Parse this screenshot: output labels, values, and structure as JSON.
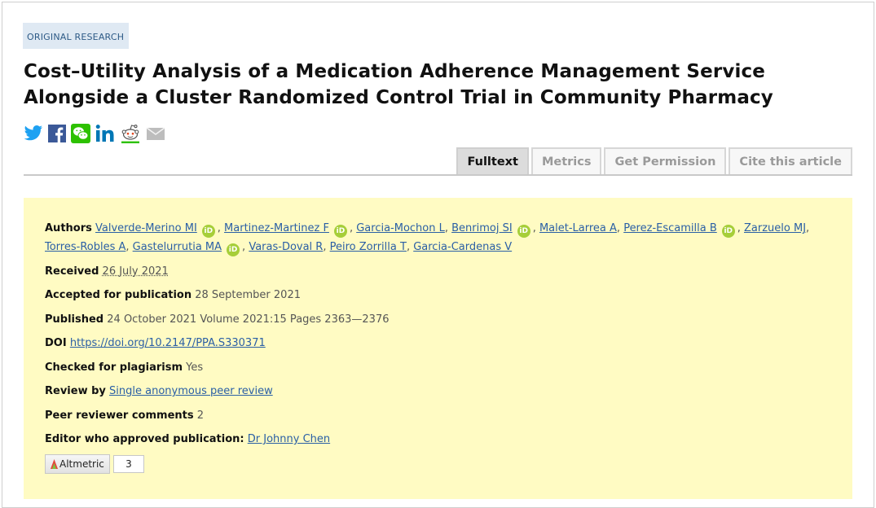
{
  "article": {
    "type_label": "ORIGINAL RESEARCH",
    "title": "Cost–Utility Analysis of a Medication Adherence Management Service Alongside a Cluster Randomized Control Trial in Community Pharmacy"
  },
  "share_icons": [
    "twitter-icon",
    "facebook-icon",
    "wechat-icon",
    "linkedin-icon",
    "reddit-icon",
    "email-icon"
  ],
  "colors": {
    "twitter": "#1da1f2",
    "facebook": "#3b5998",
    "wechat": "#2dc100",
    "linkedin": "#0077b5",
    "orcid": "#a6ce39",
    "meta_bg": "#fffbc3",
    "link": "#2a5fa5"
  },
  "tabs": [
    {
      "label": "Fulltext",
      "active": true
    },
    {
      "label": "Metrics",
      "active": false
    },
    {
      "label": "Get Permission",
      "active": false
    },
    {
      "label": "Cite this article",
      "active": false
    }
  ],
  "meta": {
    "authors_label": "Authors",
    "authors": [
      {
        "name": "Valverde-Merino MI",
        "orcid": true
      },
      {
        "name": "Martinez-Martinez F",
        "orcid": true
      },
      {
        "name": "Garcia-Mochon L",
        "orcid": false
      },
      {
        "name": "Benrimoj SI",
        "orcid": true
      },
      {
        "name": "Malet-Larrea A",
        "orcid": false
      },
      {
        "name": "Perez-Escamilla B",
        "orcid": true
      },
      {
        "name": "Zarzuelo MJ",
        "orcid": false
      },
      {
        "name": "Torres-Robles A",
        "orcid": false
      },
      {
        "name": "Gastelurrutia MA",
        "orcid": true
      },
      {
        "name": "Varas-Doval R",
        "orcid": false
      },
      {
        "name": "Peiro Zorrilla T",
        "orcid": false
      },
      {
        "name": "Garcia-Cardenas V",
        "orcid": false
      }
    ],
    "orcid_label": "iD",
    "received_label": "Received",
    "received": "26 July 2021",
    "accepted_label": "Accepted for publication",
    "accepted": "28 September 2021",
    "published_label": "Published",
    "published": "24 October 2021 Volume 2021:15 Pages 2363—2376",
    "doi_label": "DOI",
    "doi": "https://doi.org/10.2147/PPA.S330371",
    "plagiarism_label": "Checked for plagiarism",
    "plagiarism": "Yes",
    "review_label": "Review by",
    "review": "Single anonymous peer review",
    "comments_label": "Peer reviewer comments",
    "comments": "2",
    "editor_label": "Editor who approved publication:",
    "editor": "Dr Johnny Chen",
    "altmetric_label": "Altmetric",
    "altmetric_count": "3"
  }
}
